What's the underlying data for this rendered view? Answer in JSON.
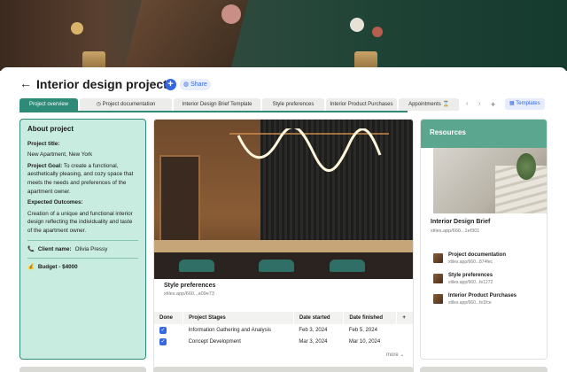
{
  "header": {
    "back_label": "←",
    "title": "Interior design project",
    "more_label": "···",
    "add_label": "+",
    "share_label": "Share"
  },
  "tabs": [
    {
      "label": "Project overview",
      "active": true
    },
    {
      "label": "Project documentation",
      "active": false
    },
    {
      "label": "Interior Design Brief Template",
      "active": false
    },
    {
      "label": "Style preferences",
      "active": false
    },
    {
      "label": "Interior Product Purchases",
      "active": false
    },
    {
      "label": "Appointments",
      "active": false
    }
  ],
  "tab_controls": {
    "prev": "‹",
    "next": "›",
    "add": "+",
    "templates_label": "Templates"
  },
  "about": {
    "heading": "About project",
    "title_label": "Project title:",
    "title_value": "New Apartment, New York",
    "goal_label": "Project Goal:",
    "goal_value": "To create a functional, aesthetically pleasing, and cozy space that meets the needs and preferences of the apartment owner.",
    "outcomes_label": "Expected Outcomes:",
    "outcomes_value": "Creation of a unique and functional interior design reflecting the individuality and taste of the apartment owner.",
    "client_label": "Client name:",
    "client_value": "Olivia Pressy",
    "budget_label": "Budget - $4000"
  },
  "style_card": {
    "title": "Style preferences",
    "url": "xtiles.app/660...a09e73"
  },
  "stages_table": {
    "columns": [
      "Done",
      "Project Stages",
      "Date started",
      "Date finished"
    ],
    "rows": [
      {
        "done": true,
        "stage": "Information Gathering and Analysis",
        "started": "Feb 3, 2024",
        "finished": "Feb 5, 2024"
      },
      {
        "done": true,
        "stage": "Concept Development",
        "started": "Mar 3, 2024",
        "finished": "Mar 10, 2024"
      }
    ],
    "more_label": "more"
  },
  "resources": {
    "heading": "Resources",
    "brief_title": "Interior Design Brief",
    "brief_url": "xtiles.app/660...1ef301",
    "items": [
      {
        "title": "Project documentation",
        "url": "xtiles.app/660...874fec"
      },
      {
        "title": "Style preferences",
        "url": "xtiles.app/660...fe1272"
      },
      {
        "title": "Interior Product Purchases",
        "url": "xtiles.app/660...fe1fce"
      }
    ]
  },
  "colors": {
    "accent": "#2e8b78",
    "panel_bg": "#c9ece1",
    "primary_blue": "#3567e0"
  }
}
